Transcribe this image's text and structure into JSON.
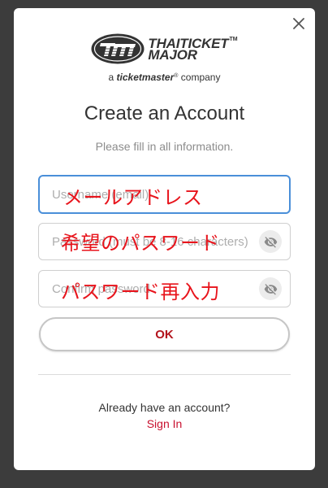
{
  "dialog": {
    "close_icon": "close-icon"
  },
  "logo": {
    "emblem_icon": "thaiticket-major-emblem",
    "brand_line1": "THAITICKET",
    "trademark": "TM",
    "brand_line2": "MAJOR",
    "tagline_prefix": "a",
    "tagline_brand": "ticketmaster",
    "tagline_registered": "®",
    "tagline_suffix": "company"
  },
  "header": {
    "title": "Create an Account",
    "subtitle": "Please fill in all information."
  },
  "form": {
    "username": {
      "placeholder": "Username (email)",
      "value": "",
      "focused": true,
      "annotation": "メールアドレス"
    },
    "password": {
      "placeholder": "Password (must be 8-16 characters)",
      "value": "",
      "annotation": "希望のパスワード",
      "toggle_icon": "eye-slash-icon"
    },
    "confirm_password": {
      "placeholder": "Confirm password",
      "value": "",
      "annotation": "パスワード再入力",
      "toggle_icon": "eye-slash-icon"
    },
    "submit_label": "OK"
  },
  "footer": {
    "prompt": "Already have an account?",
    "sign_in_label": "Sign In"
  },
  "colors": {
    "accent": "#c8102e",
    "focus_border": "#4a8fd9",
    "annotation": "#e8141c",
    "text": "#333333",
    "muted_text": "#8c8c8c",
    "overlay": "#3c3c3c"
  }
}
